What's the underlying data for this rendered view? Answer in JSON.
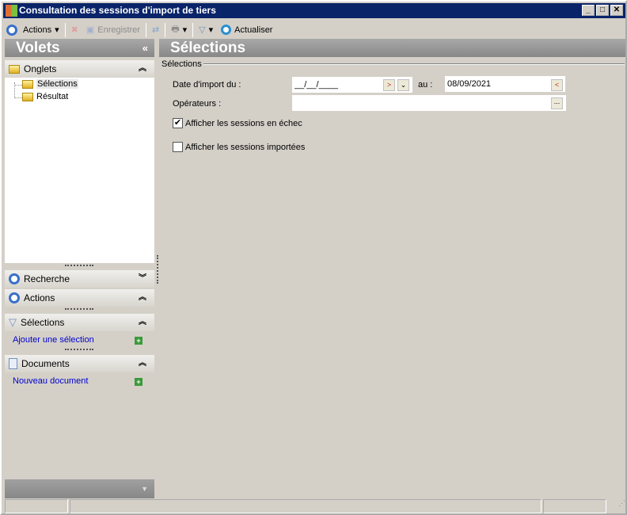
{
  "window": {
    "title": "Consultation des sessions d'import de tiers",
    "min": "_",
    "max": "□",
    "close": "✕"
  },
  "toolbar": {
    "actions": "Actions",
    "save": "Enregistrer",
    "refresh": "Actualiser"
  },
  "left": {
    "title": "Volets",
    "collapse": "«",
    "onglets": {
      "label": "Onglets",
      "items": [
        "Sélections",
        "Résultat"
      ]
    },
    "recherche": "Recherche",
    "actions": "Actions",
    "selections": {
      "label": "Sélections",
      "link": "Ajouter une sélection"
    },
    "documents": {
      "label": "Documents",
      "link": "Nouveau document"
    }
  },
  "main": {
    "title": "Sélections",
    "group": "Sélections",
    "date_label": "Date d'import du :",
    "date_from": "__/__/____",
    "au_label": "au :",
    "date_to": "08/09/2021",
    "operateurs_label": "Opérateurs :",
    "operateurs_value": "",
    "ellipsis": "...",
    "cb1": {
      "label": "Afficher les sessions en échec",
      "checked": true
    },
    "cb2": {
      "label": "Afficher les sessions importées",
      "checked": false
    }
  }
}
